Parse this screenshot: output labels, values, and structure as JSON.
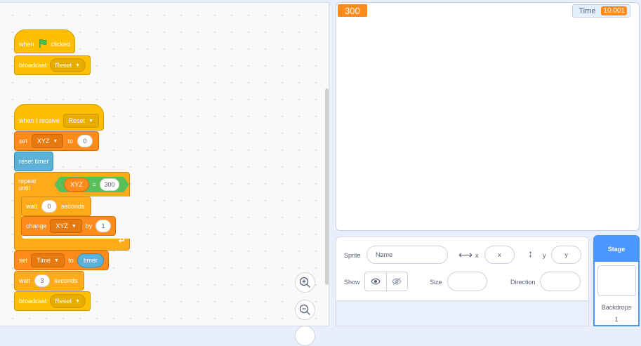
{
  "scripts": {
    "when_flag": {
      "when": "when",
      "clicked": "clicked"
    },
    "broadcast_reset_1": {
      "label": "broadcast",
      "message": "Reset"
    },
    "when_receive": {
      "label": "when I receive",
      "message": "Reset"
    },
    "set_xyz": {
      "label": "set",
      "variable": "XYZ",
      "to": "to",
      "value": "0"
    },
    "reset_timer": {
      "label": "reset timer"
    },
    "repeat_until": {
      "label": "repeat until",
      "variable": "XYZ",
      "operator": "=",
      "value": "300"
    },
    "wait_0": {
      "label": "wait",
      "value": "0",
      "unit": "seconds"
    },
    "change_xyz": {
      "label": "change",
      "variable": "XYZ",
      "by": "by",
      "value": "1"
    },
    "set_time": {
      "label": "set",
      "variable": "Time",
      "to": "to",
      "reporter": "timer"
    },
    "wait_3": {
      "label": "wait",
      "value": "3",
      "unit": "seconds"
    },
    "broadcast_reset_2": {
      "label": "broadcast",
      "message": "Reset"
    }
  },
  "stage": {
    "xyz_value": "300",
    "timer_monitor": {
      "label": "Time",
      "value": "10.001"
    }
  },
  "sprite_info": {
    "sprite_label": "Sprite",
    "name_placeholder": "Name",
    "x_label": "x",
    "x_placeholder": "x",
    "y_label": "y",
    "y_placeholder": "y",
    "show_label": "Show",
    "size_label": "Size",
    "direction_label": "Direction"
  },
  "stage_panel": {
    "title": "Stage",
    "backdrops_label": "Backdrops",
    "backdrops_count": "1"
  },
  "colors": {
    "events": "#ffbf00",
    "variables": "#ff8c1a",
    "sensing": "#5cb1d6",
    "operators": "#59c059",
    "control": "#ffab19",
    "accent": "#4c97ff"
  },
  "icons": [
    "green-flag-icon",
    "dropdown-arrow-icon",
    "loop-arrow-icon",
    "zoom-in-icon",
    "zoom-out-icon",
    "eye-icon",
    "eye-hidden-icon",
    "horizontal-arrows-icon",
    "vertical-arrows-icon"
  ]
}
